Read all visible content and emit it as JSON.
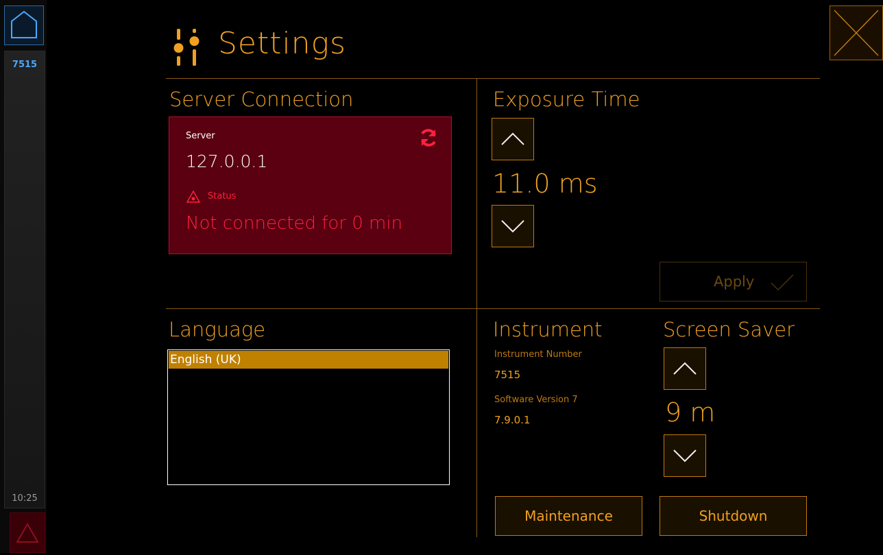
{
  "sidebar": {
    "instrument_id": "7515",
    "time": "10:25",
    "home_icon": "home-icon",
    "alarm_icon": "warning-triangle-icon"
  },
  "header": {
    "title": "Settings",
    "icon": "sliders-icon",
    "close_icon": "close-icon"
  },
  "server_connection": {
    "section_title": "Server Connection",
    "server_label": "Server",
    "server_value": "127.0.0.1",
    "status_label": "Status",
    "status_value": "Not connected for 0 min",
    "refresh_icon": "refresh-icon",
    "warning_icon": "warning-triangle-icon"
  },
  "exposure": {
    "section_title": "Exposure Time",
    "value": "11.0 ms",
    "apply_label": "Apply"
  },
  "language": {
    "section_title": "Language",
    "options": [
      "English (UK)"
    ],
    "selected": "English (UK)"
  },
  "instrument": {
    "section_title": "Instrument",
    "number_label": "Instrument Number",
    "number_value": "7515",
    "software_label": "Software Version 7",
    "software_value": "7.9.0.1"
  },
  "screen_saver": {
    "section_title": "Screen Saver",
    "value": "9 m"
  },
  "actions": {
    "maintenance_label": "Maintenance",
    "shutdown_label": "Shutdown"
  },
  "colors": {
    "accent": "#f0a020",
    "error_bg": "#5a0010",
    "error_text": "#ff2040",
    "info_blue": "#4aa8ff"
  }
}
